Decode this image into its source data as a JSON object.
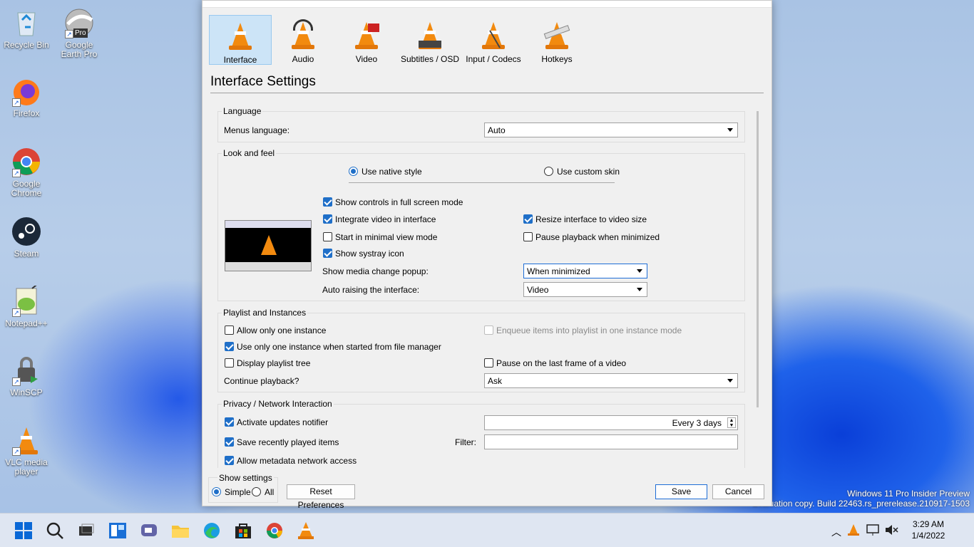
{
  "desktop": {
    "icons": [
      {
        "label": "Recycle Bin",
        "icon": "recycle-bin-icon"
      },
      {
        "label": "Google Earth Pro",
        "badge": "Pro",
        "icon": "google-earth-icon"
      },
      {
        "label": "Firefox",
        "icon": "firefox-icon"
      },
      {
        "label": "Google Chrome",
        "icon": "chrome-icon"
      },
      {
        "label": "Steam",
        "icon": "steam-icon"
      },
      {
        "label": "Notepad++",
        "icon": "notepadpp-icon"
      },
      {
        "label": "WinSCP",
        "icon": "winscp-icon"
      },
      {
        "label": "VLC media player",
        "icon": "vlc-icon"
      }
    ],
    "watermark_line1": "Windows 11 Pro Insider Preview",
    "watermark_line2": "Evaluation copy. Build 22463.rs_prerelease.210917-1503"
  },
  "prefs": {
    "categories": [
      {
        "label": "Interface",
        "selected": true
      },
      {
        "label": "Audio"
      },
      {
        "label": "Video"
      },
      {
        "label": "Subtitles / OSD"
      },
      {
        "label": "Input / Codecs"
      },
      {
        "label": "Hotkeys"
      }
    ],
    "page_title": "Interface Settings",
    "language": {
      "group": "Language",
      "menus_language_label": "Menus language:",
      "menus_language_value": "Auto"
    },
    "look": {
      "group": "Look and feel",
      "native_style": "Use native style",
      "custom_skin": "Use custom skin",
      "show_controls_fullscreen": "Show controls in full screen mode",
      "integrate_video": "Integrate video in interface",
      "resize_interface": "Resize interface to video size",
      "minimal_view": "Start in minimal view mode",
      "pause_minimized": "Pause playback when minimized",
      "systray": "Show systray icon",
      "media_change_label": "Show media change popup:",
      "media_change_value": "When minimized",
      "auto_raise_label": "Auto raising the interface:",
      "auto_raise_value": "Video"
    },
    "playlist": {
      "group": "Playlist and Instances",
      "one_instance": "Allow only one instance",
      "enqueue": "Enqueue items into playlist in one instance mode",
      "file_manager": "Use only one instance when started from file manager",
      "playlist_tree": "Display playlist tree",
      "pause_last_frame": "Pause on the last frame of a video",
      "continue_label": "Continue playback?",
      "continue_value": "Ask"
    },
    "privacy": {
      "group": "Privacy / Network Interaction",
      "updates": "Activate updates notifier",
      "updates_value": "Every 3 days",
      "recent": "Save recently played items",
      "filter_label": "Filter:",
      "filter_value": "",
      "metadata": "Allow metadata network access"
    },
    "show_settings": {
      "label": "Show settings",
      "simple": "Simple",
      "all": "All"
    },
    "buttons": {
      "reset": "Reset Preferences",
      "save": "Save",
      "cancel": "Cancel"
    }
  },
  "taskbar": {
    "time": "3:29 AM",
    "date": "1/4/2022"
  }
}
